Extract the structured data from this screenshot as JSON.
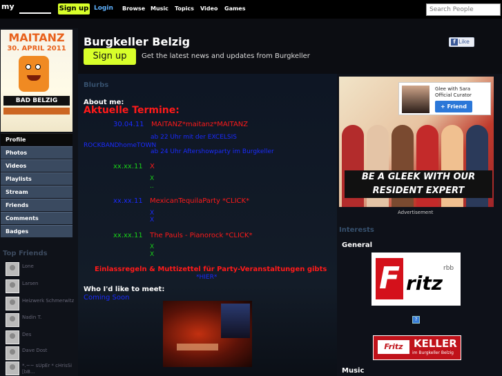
{
  "topbar": {
    "logo": "my",
    "signup": "Sign up",
    "login": "Login",
    "nav": [
      "Browse",
      "Music",
      "Topics",
      "Video",
      "Games"
    ],
    "search_placeholder": "Search People"
  },
  "header": {
    "title": "Burgkeller Belzig",
    "signup": "Sign up",
    "tagline": "Get the latest news and updates from Burgkeller",
    "like": "Like"
  },
  "poster": {
    "title": "MAITANZ",
    "date": "30. APRIL 2011",
    "town": "BAD BELZIG"
  },
  "menu": [
    "Profile",
    "Photos",
    "Videos",
    "Playlists",
    "Stream",
    "Friends",
    "Comments",
    "Badges"
  ],
  "top_friends": {
    "title": "Top Friends",
    "names": [
      "Lone",
      "Larsen",
      "Heizwerk Schmerwitz",
      "Nadin T.",
      "Des",
      "Dave Dost",
      "*.~~ sUpEr * cHrisSi [bB..."
    ]
  },
  "blurbs": {
    "heading": "Blurbs",
    "about_label": "About me:",
    "termine": "Aktuelle Termine:",
    "events": [
      {
        "date": "30.04.11",
        "title": "MAITANZ*maitanz*MAITANZ"
      },
      {
        "date": "xx.xx.11",
        "title": "X"
      },
      {
        "date": "xx.xx.11",
        "title": "MexicanTequilaParty *CLICK*"
      },
      {
        "date": "xx.xx.11",
        "title": "The Pauls - Pianorock *CLICK*"
      }
    ],
    "notes": [
      "ab 22 Uhr mit der EXCELSIS",
      "ROCKBANDhomeTOWN",
      "ab 24 Uhr Aftershowparty im Burgkeller"
    ],
    "x_marks": [
      "X",
      "X",
      "X",
      "X",
      "X",
      ".."
    ],
    "einlass": "Einlassregeln & Muttizettel für Party-Veranstaltungen gibts",
    "hier": "*HIER*",
    "meet_label": "Who I'd like to meet:",
    "meet_value": "Coming Soon"
  },
  "ad": {
    "curator_name": "Glee with Sara",
    "curator_role": "Official Curator",
    "curator_button": "+ Friend",
    "banner_line1": "BE A GLEEK WITH OUR",
    "banner_line2": "RESIDENT EXPERT",
    "label": "Advertisement"
  },
  "interests": {
    "heading": "Interests",
    "general": "General",
    "fritz": "ritz",
    "fritz_f": "F",
    "fritz_rbb": "rbb",
    "keller_f": "Fritz",
    "keller": "KELLER",
    "keller_sub": "im Burgkeller Belzig",
    "music": "Music"
  }
}
